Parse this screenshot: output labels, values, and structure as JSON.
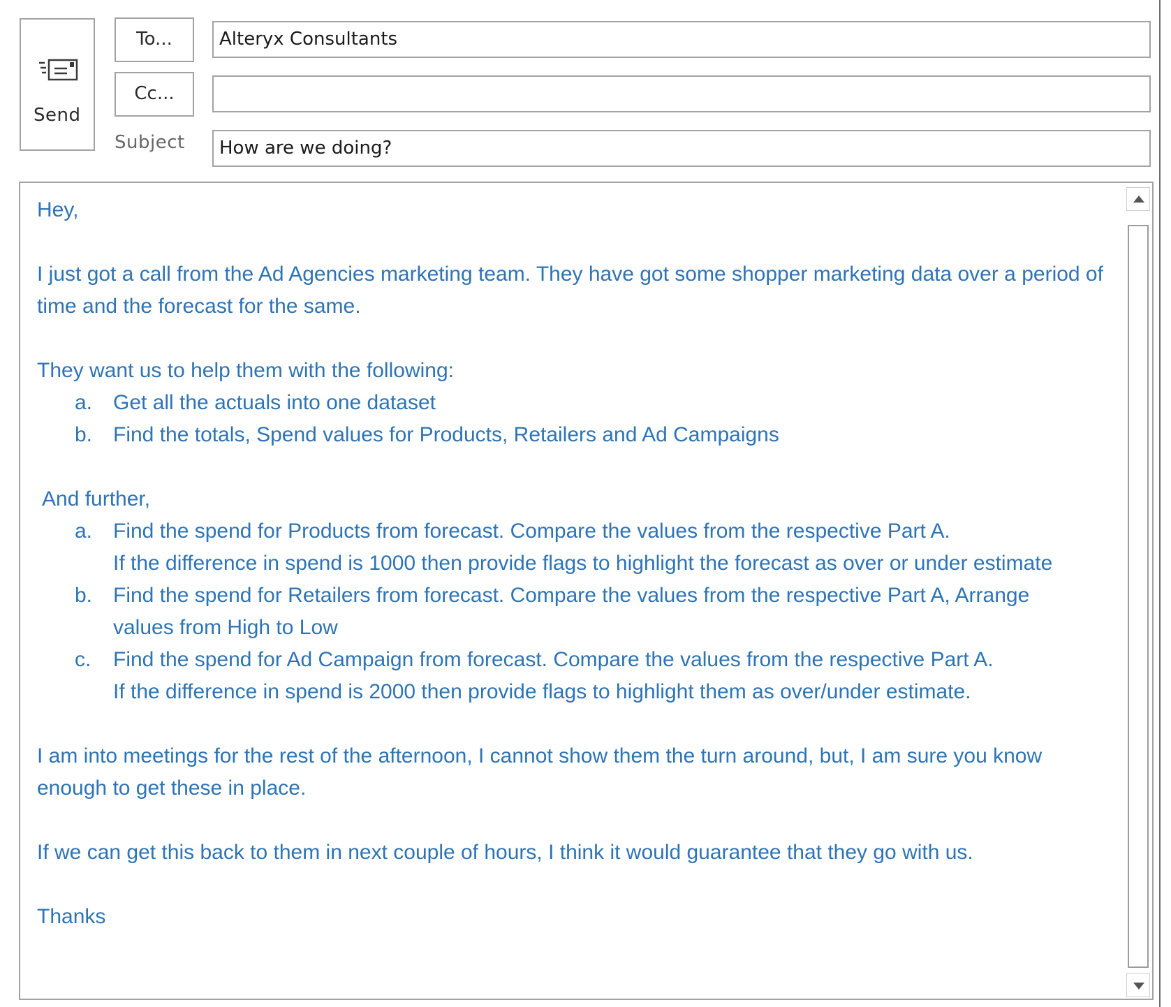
{
  "compose": {
    "send_label": "Send",
    "to_button_label": "To...",
    "cc_button_label": "Cc...",
    "subject_label": "Subject",
    "to_value": "Alteryx Consultants",
    "cc_value": "",
    "subject_value": "How are we doing?"
  },
  "message": {
    "greeting": "Hey,",
    "intro": "I  just got a call from the Ad Agencies marketing team. They have got some shopper marketing data over a period of time and the forecast for the same.",
    "request_intro": "They want us to help them with the following:",
    "part_a_items": [
      {
        "marker": "a.",
        "text": "Get all the actuals into one dataset"
      },
      {
        "marker": "b.",
        "text": "Find the totals, Spend values for Products, Retailers and Ad Campaigns"
      }
    ],
    "further_intro": "And further,",
    "part_b_items": [
      {
        "marker": "a.",
        "text": "Find the spend for Products from forecast. Compare the values from the respective Part A.",
        "text2": "If the difference in spend is 1000 then provide flags to highlight the forecast as over or under estimate"
      },
      {
        "marker": "b.",
        "text": "Find the spend for Retailers from forecast. Compare the values from the respective Part A, Arrange",
        "text2": "values from High to Low"
      },
      {
        "marker": "c.",
        "text": "Find the spend for Ad Campaign from forecast. Compare the values from the respective Part A.",
        "text2": "If the difference in spend is 2000 then provide flags to highlight them as over/under estimate."
      }
    ],
    "meetings_line1": "I am into meetings for the rest of the afternoon, I cannot show them the turn around, but, I am sure you know",
    "meetings_line2": "enough to get these in place.",
    "closing_note": "If we can get this back to them in next couple of hours, I think it would guarantee that they go with us.",
    "signoff": "Thanks"
  },
  "icons": {
    "send": "envelope-send-icon",
    "scroll_up": "scroll-up-arrow-icon",
    "scroll_down": "scroll-down-arrow-icon"
  },
  "colors": {
    "body_text": "#2e74b5",
    "border": "#a3a3a3"
  }
}
